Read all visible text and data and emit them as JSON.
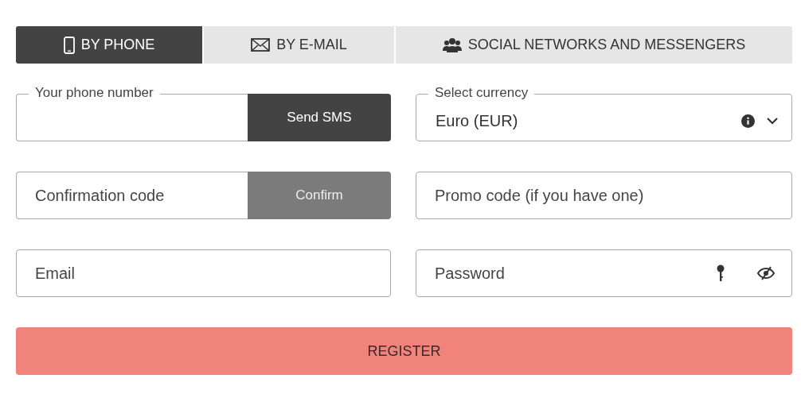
{
  "tabs": [
    {
      "label": "BY PHONE",
      "selected": true
    },
    {
      "label": "BY E-MAIL",
      "selected": false
    },
    {
      "label": "SOCIAL NETWORKS AND MESSENGERS",
      "selected": false
    }
  ],
  "phone": {
    "label": "Your phone number",
    "button": "Send SMS"
  },
  "currency": {
    "label": "Select currency",
    "value": "Euro (EUR)"
  },
  "confirmation": {
    "placeholder": "Confirmation code",
    "button": "Confirm",
    "disabled": true
  },
  "promo": {
    "placeholder": "Promo code (if you have one)"
  },
  "email": {
    "placeholder": "Email"
  },
  "password": {
    "placeholder": "Password"
  },
  "register": {
    "label": "REGISTER"
  }
}
